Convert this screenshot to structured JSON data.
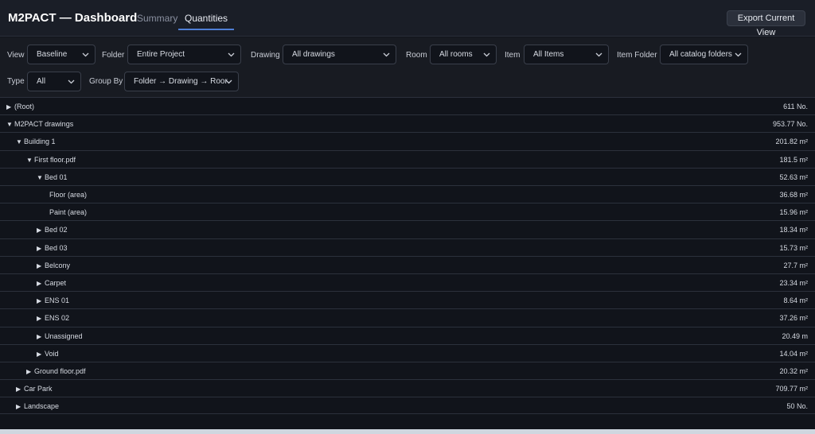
{
  "header": {
    "title": "M2PACT — Dashboard",
    "tabs": [
      "Summary",
      "Quantities"
    ],
    "active_tab": "Quantities",
    "export_label": "Export Current View"
  },
  "filters": {
    "view": {
      "label": "View",
      "value": "Baseline"
    },
    "folder": {
      "label": "Folder",
      "value": "Entire Project"
    },
    "drawing": {
      "label": "Drawing",
      "value": "All drawings"
    },
    "room": {
      "label": "Room",
      "value": "All rooms"
    },
    "item": {
      "label": "Item",
      "value": "All Items"
    },
    "item_folder": {
      "label": "Item Folder",
      "value": "All catalog folders"
    },
    "type": {
      "label": "Type",
      "value": "All"
    },
    "group_by": {
      "label": "Group By",
      "value": "Folder → Drawing → Roor"
    }
  },
  "tree": [
    {
      "caret": "▶",
      "label": "(Root)",
      "value": "611 No.",
      "depth": 0
    },
    {
      "caret": "▼",
      "label": "M2PACT drawings",
      "value": "953.77 No.",
      "depth": 0
    },
    {
      "caret": "▼",
      "label": "Building 1",
      "value": "201.82 m²",
      "depth": 1
    },
    {
      "caret": "▼",
      "label": "First floor.pdf",
      "value": "181.5 m²",
      "depth": 2
    },
    {
      "caret": "▼",
      "label": "Bed 01",
      "value": "52.63 m²",
      "depth": 3
    },
    {
      "caret": "",
      "label": "Floor (area)",
      "value": "36.68 m²",
      "depth": 4
    },
    {
      "caret": "",
      "label": "Paint (area)",
      "value": "15.96 m²",
      "depth": 4
    },
    {
      "caret": "▶",
      "label": "Bed 02",
      "value": "18.34 m²",
      "depth": 3
    },
    {
      "caret": "▶",
      "label": "Bed 03",
      "value": "15.73 m²",
      "depth": 3
    },
    {
      "caret": "▶",
      "label": "Belcony",
      "value": "27.7 m²",
      "depth": 3
    },
    {
      "caret": "▶",
      "label": "Carpet",
      "value": "23.34 m²",
      "depth": 3
    },
    {
      "caret": "▶",
      "label": "ENS 01",
      "value": "8.64 m²",
      "depth": 3
    },
    {
      "caret": "▶",
      "label": "ENS 02",
      "value": "37.26 m²",
      "depth": 3
    },
    {
      "caret": "▶",
      "label": "Unassigned",
      "value": "20.49 m",
      "depth": 3
    },
    {
      "caret": "▶",
      "label": "Void",
      "value": "14.04 m²",
      "depth": 3
    },
    {
      "caret": "▶",
      "label": "Ground floor.pdf",
      "value": "20.32 m²",
      "depth": 2
    },
    {
      "caret": "▶",
      "label": "Car Park",
      "value": "709.77 m²",
      "depth": 1
    },
    {
      "caret": "▶",
      "label": "Landscape",
      "value": "50 No.",
      "depth": 1
    }
  ],
  "colors": {
    "accent": "#4f7fd6",
    "background": "#11141b",
    "panel": "#1a1e27"
  },
  "icons": {
    "select": "chevron-down-icon"
  }
}
